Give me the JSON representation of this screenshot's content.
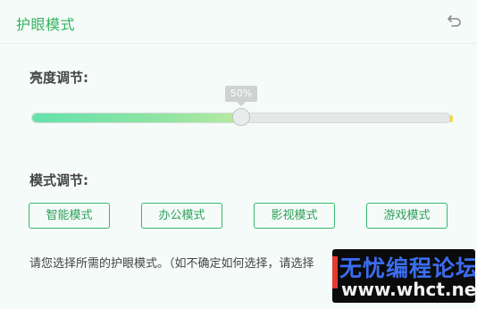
{
  "window": {
    "title": "护眼模式",
    "reset_icon": "undo-icon"
  },
  "brightness": {
    "label": "亮度调节:",
    "value_text": "50%",
    "value": 0.5
  },
  "mode": {
    "label": "模式调节:",
    "buttons": [
      "智能模式",
      "办公模式",
      "影视模式",
      "游戏模式"
    ]
  },
  "hint": "请您选择所需的护眼模式。（如不确定如何选择，请选择",
  "watermark": {
    "line1": "无忧编程论坛",
    "line2": "www.whct.net"
  },
  "colors": {
    "accent": "#33b35e",
    "slider_start": "#63e2ad",
    "slider_end": "#b7eaa0"
  }
}
